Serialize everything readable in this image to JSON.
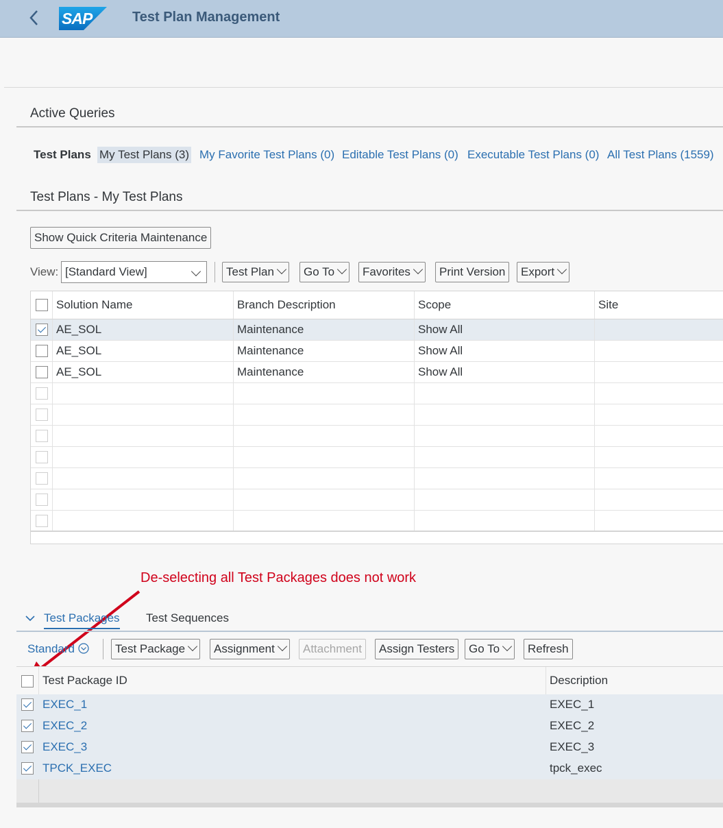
{
  "header": {
    "back_icon": "chevron-left-icon",
    "logo_text": "SAP",
    "title": "Test Plan Management"
  },
  "active_queries": {
    "title": "Active Queries",
    "label": "Test Plans",
    "links": [
      "My Test Plans (3)",
      "My Favorite Test Plans (0)",
      "Editable Test Plans (0)",
      "Executable Test Plans (0)",
      "All Test Plans (1559)"
    ],
    "selected_index": 0
  },
  "plans": {
    "title": "Test Plans - My Test Plans",
    "quick_criteria_button": "Show Quick Criteria Maintenance",
    "view_label": "View:",
    "view_value": "[Standard View]",
    "toolbar": {
      "test_plan": "Test Plan",
      "go_to": "Go To",
      "favorites": "Favorites",
      "print_version": "Print Version",
      "export": "Export"
    },
    "columns": [
      "Solution Name",
      "Branch Description",
      "Scope",
      "Site"
    ],
    "rows": [
      {
        "checked": true,
        "solution": "AE_SOL",
        "branch": "Maintenance",
        "scope": "Show All",
        "site": ""
      },
      {
        "checked": false,
        "solution": "AE_SOL",
        "branch": "Maintenance",
        "scope": "Show All",
        "site": ""
      },
      {
        "checked": false,
        "solution": "AE_SOL",
        "branch": "Maintenance",
        "scope": "Show All",
        "site": ""
      }
    ]
  },
  "annotation": {
    "text": "De-selecting all Test Packages does not work",
    "color": "#d0021b"
  },
  "packages": {
    "tabs": [
      "Test Packages",
      "Test Sequences"
    ],
    "variant_label": "Standard",
    "toolbar": {
      "test_package": "Test Package",
      "assignment": "Assignment",
      "attachment": "Attachment",
      "assign_testers": "Assign Testers",
      "go_to": "Go To",
      "refresh": "Refresh"
    },
    "columns": [
      "Test Package ID",
      "Description"
    ],
    "rows": [
      {
        "checked": true,
        "id": "EXEC_1",
        "description": "EXEC_1"
      },
      {
        "checked": true,
        "id": "EXEC_2",
        "description": "EXEC_2"
      },
      {
        "checked": true,
        "id": "EXEC_3",
        "description": "EXEC_3"
      },
      {
        "checked": true,
        "id": "TPCK_EXEC",
        "description": "tpck_exec"
      }
    ]
  },
  "colors": {
    "shell_bar": "#b6cade",
    "link": "#2b6fb0",
    "selection_row": "#e5ebf1",
    "annotation": "#d0021b"
  }
}
